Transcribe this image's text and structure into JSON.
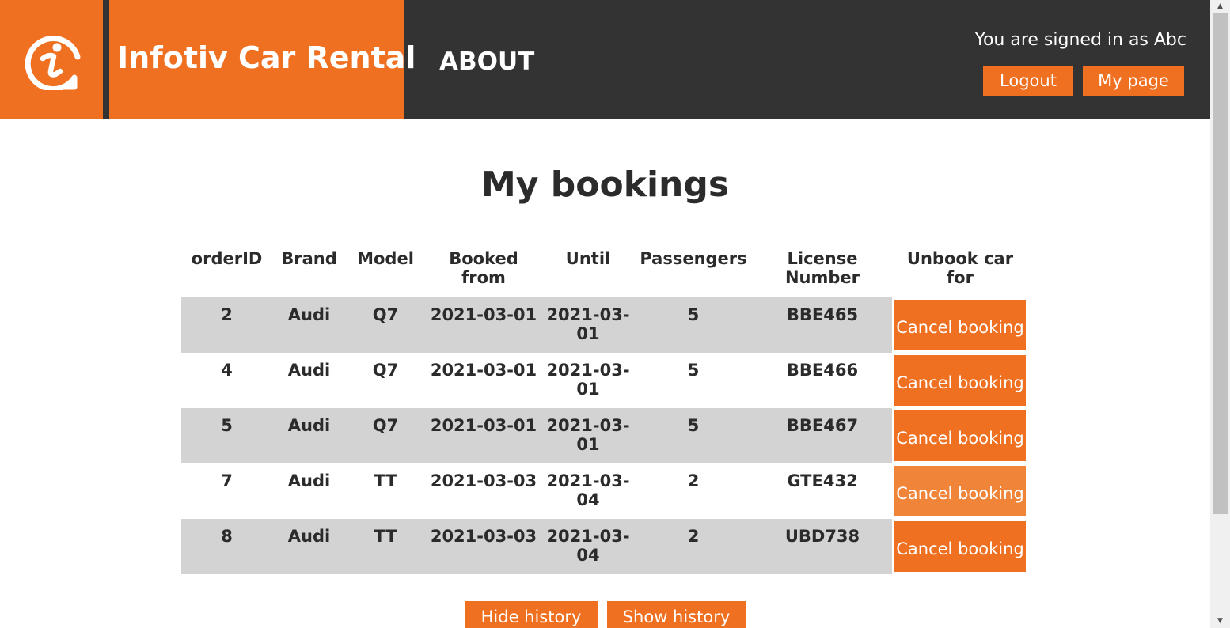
{
  "header": {
    "brand_title": "Infotiv Car Rental",
    "logo_icon": "infotiv-logo-icon",
    "nav_about": "ABOUT",
    "signed_in_text": "You are signed in as Abc",
    "logout_label": "Logout",
    "mypage_label": "My page",
    "colors": {
      "accent": "#ee7020",
      "dark": "#333333"
    }
  },
  "main": {
    "title": "My bookings",
    "table": {
      "headers": [
        "orderID",
        "Brand",
        "Model",
        "Booked from",
        "Until",
        "Passengers",
        "License Number",
        "Unbook car for"
      ],
      "rows": [
        {
          "orderID": "2",
          "brand": "Audi",
          "model": "Q7",
          "from": "2021-03-01",
          "until": "2021-03-01",
          "passengers": "5",
          "license": "BBE465",
          "action": "Cancel booking"
        },
        {
          "orderID": "4",
          "brand": "Audi",
          "model": "Q7",
          "from": "2021-03-01",
          "until": "2021-03-01",
          "passengers": "5",
          "license": "BBE466",
          "action": "Cancel booking"
        },
        {
          "orderID": "5",
          "brand": "Audi",
          "model": "Q7",
          "from": "2021-03-01",
          "until": "2021-03-01",
          "passengers": "5",
          "license": "BBE467",
          "action": "Cancel booking"
        },
        {
          "orderID": "7",
          "brand": "Audi",
          "model": "TT",
          "from": "2021-03-03",
          "until": "2021-03-04",
          "passengers": "2",
          "license": "GTE432",
          "action": "Cancel booking"
        },
        {
          "orderID": "8",
          "brand": "Audi",
          "model": "TT",
          "from": "2021-03-03",
          "until": "2021-03-04",
          "passengers": "2",
          "license": "UBD738",
          "action": "Cancel booking"
        }
      ]
    },
    "hide_history_label": "Hide history",
    "show_history_label": "Show history"
  },
  "scrollbar": {
    "up_icon": "scroll-up-arrow-icon",
    "down_icon": "scroll-down-arrow-icon"
  }
}
